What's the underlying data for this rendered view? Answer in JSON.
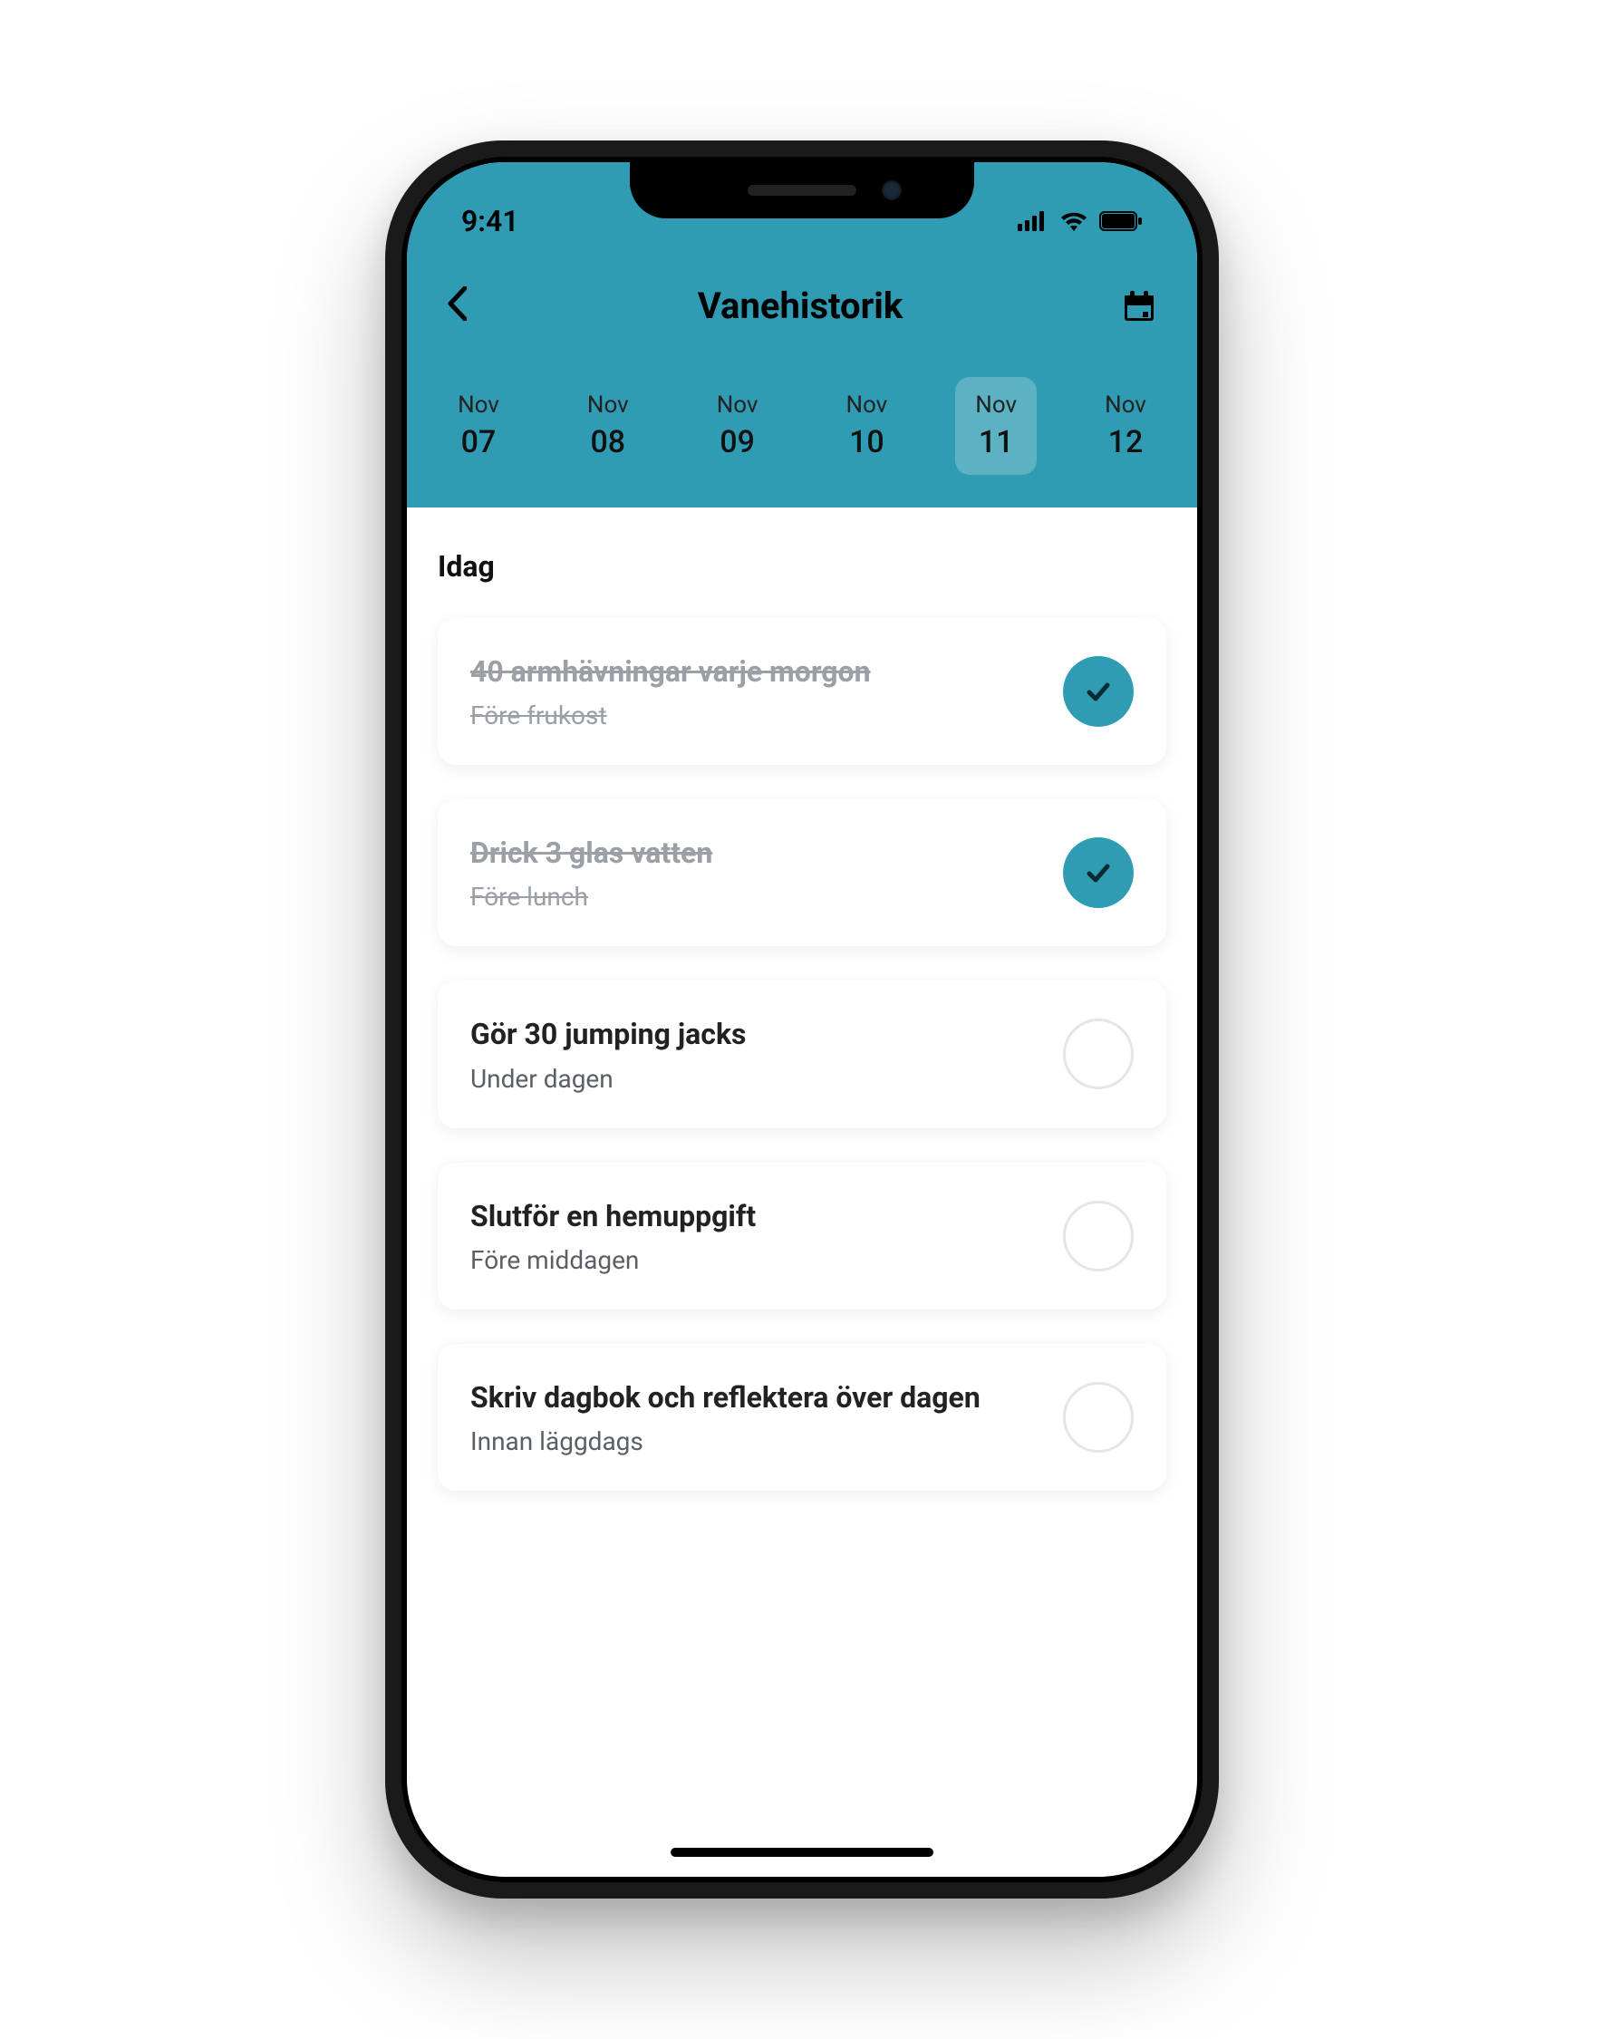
{
  "status": {
    "time": "9:41"
  },
  "header": {
    "title": "Vanehistorik"
  },
  "dates": [
    {
      "month": "Nov",
      "day": "07",
      "selected": false
    },
    {
      "month": "Nov",
      "day": "08",
      "selected": false
    },
    {
      "month": "Nov",
      "day": "09",
      "selected": false
    },
    {
      "month": "Nov",
      "day": "10",
      "selected": false
    },
    {
      "month": "Nov",
      "day": "11",
      "selected": true
    },
    {
      "month": "Nov",
      "day": "12",
      "selected": false
    }
  ],
  "section_label": "Idag",
  "habits": [
    {
      "title": "40 armhävningar varje morgon",
      "subtitle": "Före frukost",
      "done": true
    },
    {
      "title": "Drick 3 glas vatten",
      "subtitle": "Före lunch",
      "done": true
    },
    {
      "title": "Gör 30 jumping jacks",
      "subtitle": "Under dagen",
      "done": false
    },
    {
      "title": "Slutför en hemuppgift",
      "subtitle": "Före middagen",
      "done": false
    },
    {
      "title": "Skriv dagbok och reflektera över dagen",
      "subtitle": "Innan läggdags",
      "done": false
    }
  ],
  "colors": {
    "accent": "#2f9cb3"
  }
}
